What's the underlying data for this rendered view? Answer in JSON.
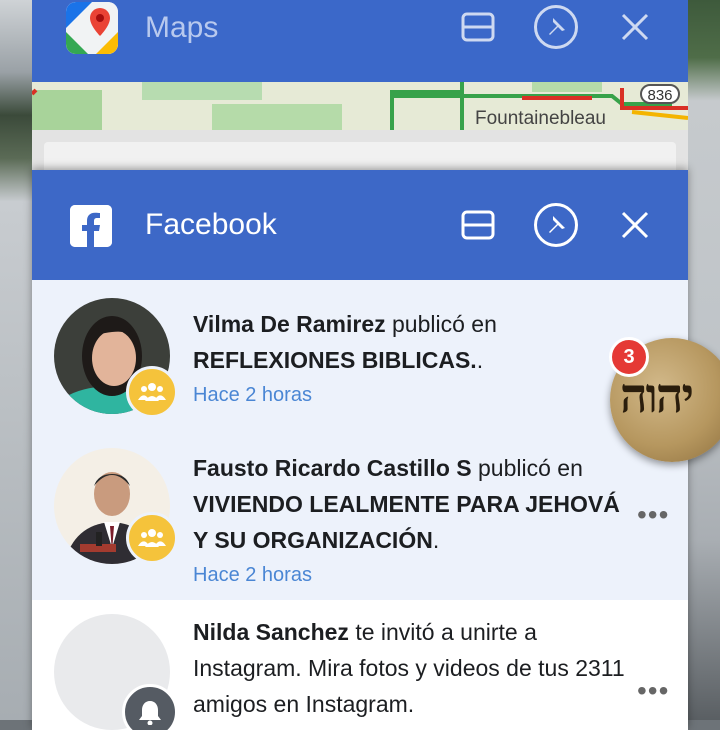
{
  "maps": {
    "title": "Maps",
    "map_label": "Fountainebleau",
    "route_badge": "836"
  },
  "facebook": {
    "title": "Facebook",
    "notifications": [
      {
        "author": "Vilma De Ramirez",
        "action": " publicó en ",
        "target": "REFLEXIONES BIBLICAS.",
        "suffix": ".",
        "time": "Hace 2 horas"
      },
      {
        "author": "Fausto Ricardo Castillo S",
        "action": " publicó en ",
        "target": "VIVIENDO LEALMENTE PARA JEHOVÁ Y SU ORGANIZACIÓN",
        "suffix": ".",
        "time": "Hace 2 horas"
      },
      {
        "author": "Nilda Sanchez",
        "action": " te invitó a unirte a Instagram. Mira fotos y videos de tus 2311 amigos en Instagram."
      }
    ],
    "more_label": "•••"
  },
  "chat_head": {
    "badge_count": "3",
    "image_text": "יהוה"
  },
  "colors": {
    "titlebar": "#3d68c7",
    "unread_bg": "#edf2fb",
    "time": "#4a86d4",
    "group_badge": "#f5c33b",
    "count_badge": "#e53935"
  }
}
